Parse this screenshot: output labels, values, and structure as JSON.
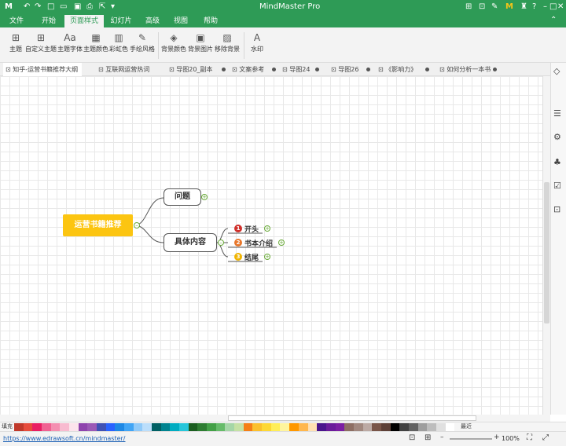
{
  "app": {
    "title": "MindMaster Pro",
    "logo": "M"
  },
  "quick_access": [
    "undo-icon",
    "redo-icon",
    "new-icon",
    "open-icon",
    "save-icon",
    "print-icon",
    "export-icon",
    "more-icon"
  ],
  "window_controls": [
    "share-icon",
    "gift-icon",
    "pen-icon",
    "member-icon",
    "shirt-icon",
    "help-icon",
    "minimize-icon",
    "maximize-icon",
    "close-icon"
  ],
  "menu": {
    "tabs": [
      "文件",
      "开始",
      "页面样式",
      "幻灯片",
      "高级",
      "视图",
      "帮助"
    ],
    "active": "页面样式"
  },
  "ribbon": {
    "buttons": [
      {
        "label": "主题",
        "icon": "⊞"
      },
      {
        "label": "自定义主题",
        "icon": "⊞"
      },
      {
        "label": "主题字体",
        "icon": "Aa"
      },
      {
        "label": "主题颜色",
        "icon": "▦"
      },
      {
        "label": "彩虹色",
        "icon": "▥"
      },
      {
        "label": "手绘风格",
        "icon": "✎"
      },
      {
        "label": "背景颜色",
        "icon": "◈"
      },
      {
        "label": "背景图片",
        "icon": "▣"
      },
      {
        "label": "移除背景",
        "icon": "▨"
      },
      {
        "label": "水印",
        "icon": "A"
      }
    ]
  },
  "doc_tabs": [
    "知乎-运营书籍推荐大纲",
    "互联网运营热词",
    "导图20_副本",
    "文案参考",
    "导图24",
    "导图26",
    "《影响力》",
    "如何分析一本书"
  ],
  "mindmap": {
    "root": "运营书籍推荐",
    "branches": [
      "问题",
      "具体内容"
    ],
    "sub": [
      {
        "num": "1",
        "label": "开头",
        "color": "#d0302b"
      },
      {
        "num": "2",
        "label": "书本介绍",
        "color": "#e8762a"
      },
      {
        "num": "3",
        "label": "结尾",
        "color": "#f0b400"
      }
    ],
    "root_color": "#fcc511"
  },
  "colorbar": {
    "label": "填充",
    "recent": "最近"
  },
  "status": {
    "url": "https://www.edrawsoft.cn/mindmaster/",
    "zoom": "100%"
  },
  "colors": {
    "brand": "#2e9b56"
  }
}
